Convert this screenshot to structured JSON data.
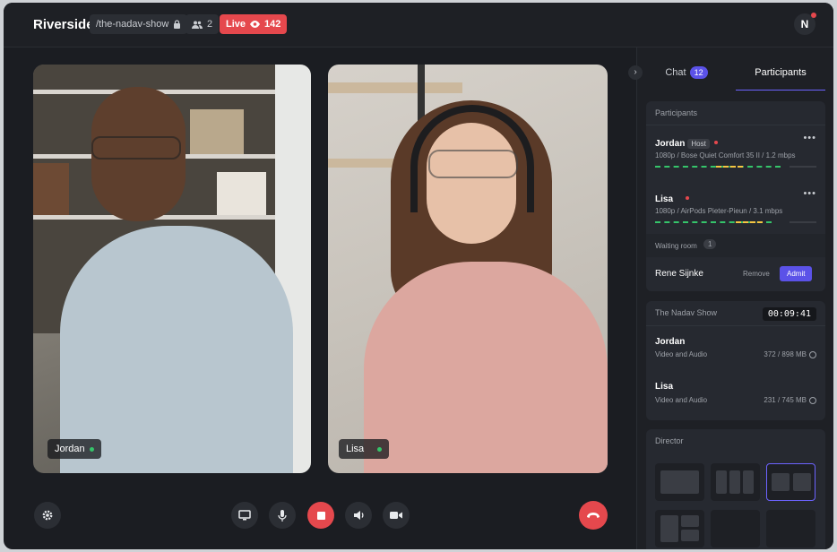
{
  "app": {
    "name": "Riverside",
    "slug": "/the-nadav-show",
    "people_count": "2",
    "live_label": "Live",
    "viewers": "142",
    "user_initial": "N"
  },
  "icons": {
    "lock": "lock-icon",
    "people": "people-icon",
    "eye": "eye-icon"
  },
  "tiles": [
    {
      "name": "Jordan"
    },
    {
      "name": "Lisa"
    }
  ],
  "panel": {
    "tabs": {
      "chat": "Chat",
      "chat_count": "12",
      "participants": "Participants"
    },
    "participants_header": "Participants",
    "participants": [
      {
        "name": "Jordan",
        "role": "Host",
        "detail": "1080p / Bose Quiet Comfort 35 II / 1.2 mbps"
      },
      {
        "name": "Lisa",
        "detail": "1080p / AirPods Pieter-Pieun / 3.1 mbps"
      }
    ],
    "waiting_room": {
      "label": "Waiting room",
      "count": "1",
      "person": "Rene Sijnke",
      "remove": "Remove",
      "admit": "Admit"
    },
    "show": {
      "title": "The Nadav Show",
      "timer": "00:09:41",
      "tracks": [
        {
          "name": "Jordan",
          "type": "Video and Audio",
          "size": "372 / 898 MB"
        },
        {
          "name": "Lisa",
          "type": "Video and Audio",
          "size": "231 / 745 MB"
        }
      ]
    },
    "director": {
      "label": "Director"
    }
  },
  "colors": {
    "accent": "#5b52e8",
    "live": "#e5484d",
    "online": "#35c46a"
  }
}
